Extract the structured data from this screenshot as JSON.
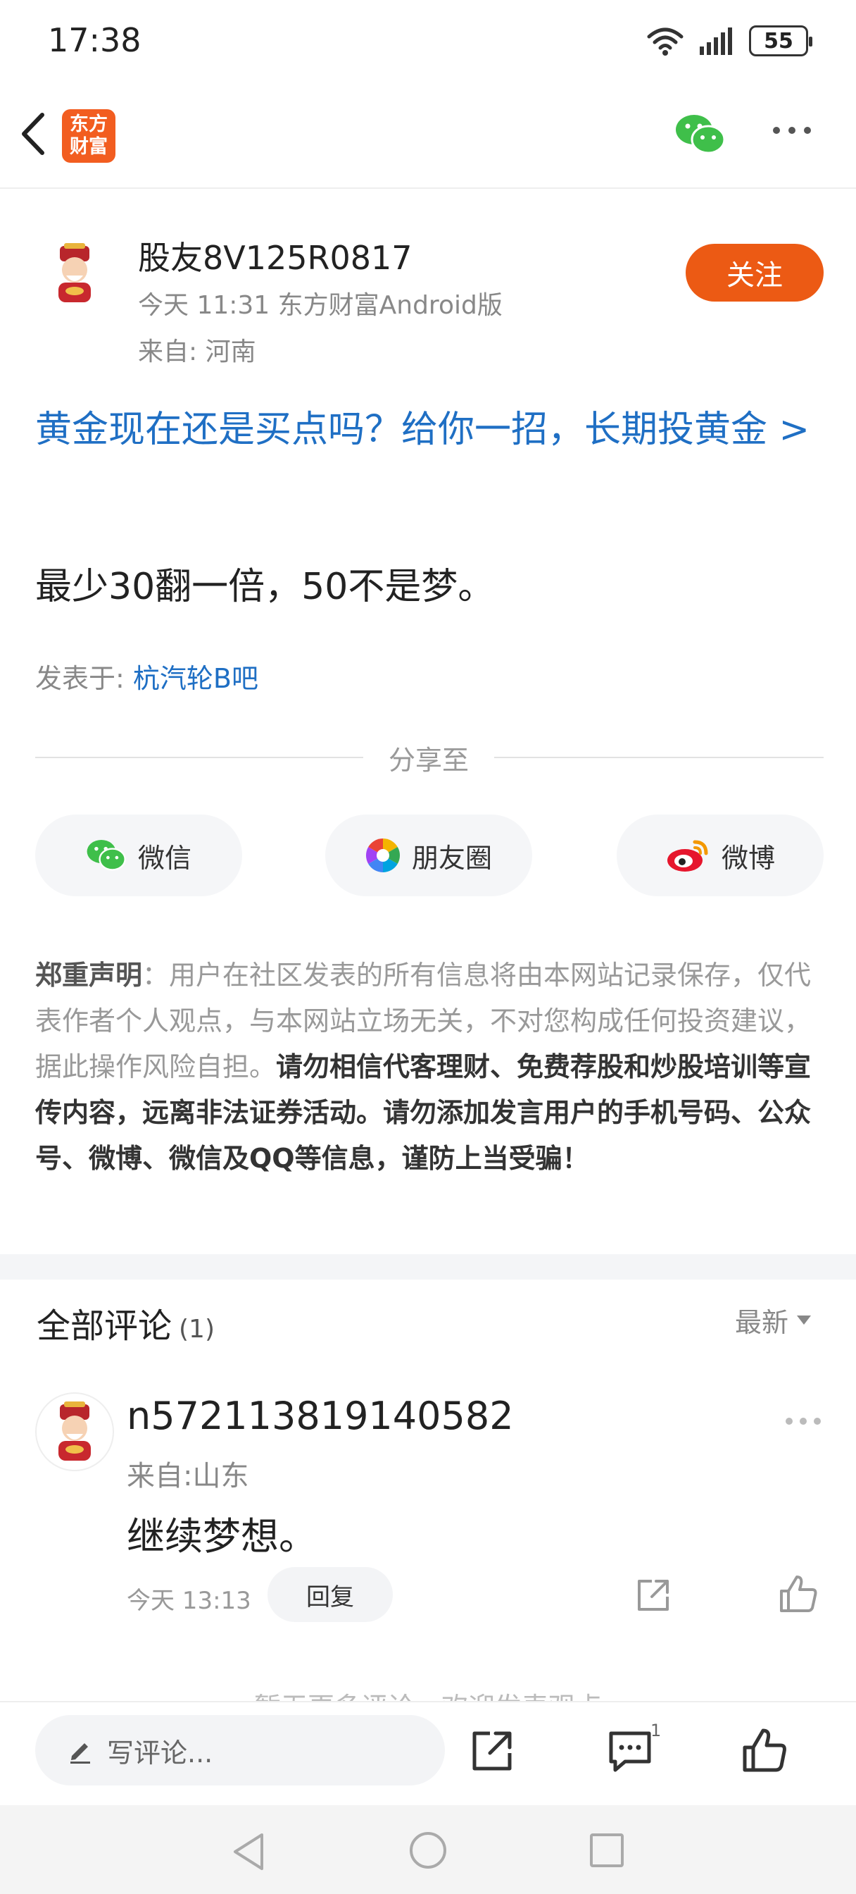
{
  "status_bar": {
    "time": "17:38",
    "battery": "55"
  },
  "header": {
    "logo_line1": "东方",
    "logo_line2": "财富"
  },
  "author": {
    "name": "股友8V125R0817",
    "time_source": "今天 11:31 东方财富Android版",
    "location": "来自: 河南",
    "follow_label": "关注"
  },
  "post": {
    "title": "黄金现在还是买点吗？给你一招，长期投黄金 >",
    "body": "最少30翻一倍，50不是梦。",
    "origin_prefix": "发表于:",
    "origin_link": "杭汽轮B吧"
  },
  "share": {
    "label": "分享至",
    "buttons": [
      {
        "label": "微信",
        "icon": "wechat-icon"
      },
      {
        "label": "朋友圈",
        "icon": "moments-icon"
      },
      {
        "label": "微博",
        "icon": "weibo-icon"
      }
    ]
  },
  "disclaimer": {
    "heading": "郑重声明",
    "normal": "：用户在社区发表的所有信息将由本网站记录保存，仅代表作者个人观点，与本网站立场无关，不对您构成任何投资建议，据此操作风险自担。",
    "strong": "请勿相信代客理财、免费荐股和炒股培训等宣传内容，远离非法证券活动。请勿添加发言用户的手机号码、公众号、微博、微信及QQ等信息，谨防上当受骗！"
  },
  "comments": {
    "title": "全部评论",
    "count": "(1)",
    "sort_label": "最新",
    "items": [
      {
        "user": "n572113819140582",
        "location": "来自:山东",
        "text": "继续梦想。",
        "time": "今天 13:13",
        "reply_label": "回复"
      }
    ],
    "no_more": "暂无更多评论，欢迎发表观点"
  },
  "bottom_bar": {
    "input_placeholder": "写评论...",
    "comment_badge": "1"
  },
  "colors": {
    "accent": "#ec5a14",
    "link": "#1f6fc4",
    "wechat": "#3fbf4a",
    "logo": "#f25d20"
  }
}
